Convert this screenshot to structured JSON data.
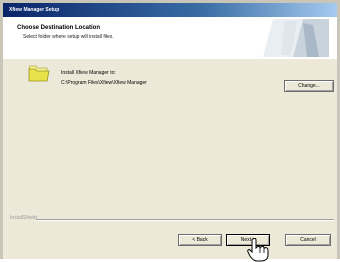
{
  "window": {
    "title": "Xfiew Manager Setup"
  },
  "header": {
    "title": "Choose Destination Location",
    "subtitle": "Select folder where setup will install files."
  },
  "content": {
    "install_label": "Install Xfiew Manager to:",
    "install_path": "C:\\Program Files\\Xfiew\\Xfiew Manager"
  },
  "buttons": {
    "change": "Change...",
    "back": "< Back",
    "next": "Next >",
    "cancel": "Cancel"
  },
  "footer": {
    "brand": "InstallShield"
  },
  "icons": {
    "folder": "folder-icon",
    "header_graphic": "wizard-graphic",
    "cursor": "hand-pointer-icon"
  },
  "colors": {
    "titlebar_start": "#0a246a",
    "titlebar_end": "#a6caf0",
    "dialog_bg": "#ece9d8",
    "folder": "#e8e24a"
  }
}
